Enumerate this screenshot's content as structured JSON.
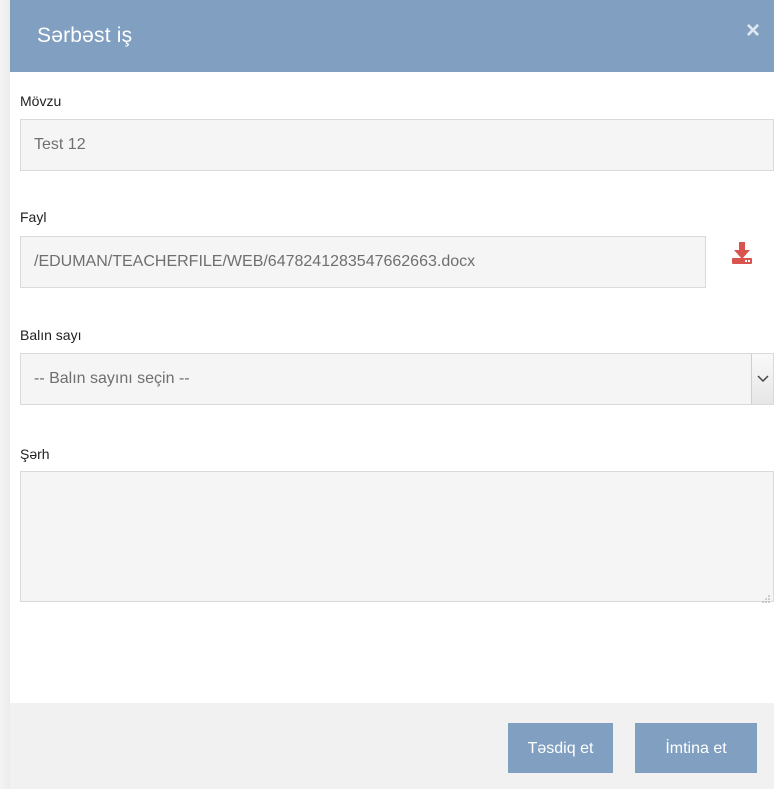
{
  "modal": {
    "title": "Sərbəst iş",
    "close_label": "×"
  },
  "form": {
    "topic": {
      "label": "Mövzu",
      "value": "Test 12"
    },
    "file": {
      "label": "Fayl",
      "value": "/EDUMAN/TEACHERFILE/WEB/6478241283547662663.docx",
      "download_icon": "download-icon"
    },
    "score": {
      "label": "Balın sayı",
      "selected": "-- Balın sayını seçin --"
    },
    "comment": {
      "label": "Şərh",
      "value": ""
    }
  },
  "footer": {
    "confirm_label": "Təsdiq et",
    "cancel_label": "İmtina et"
  },
  "colors": {
    "header": "#809fc1",
    "button": "#809fc1",
    "download_icon": "#d9534f"
  }
}
